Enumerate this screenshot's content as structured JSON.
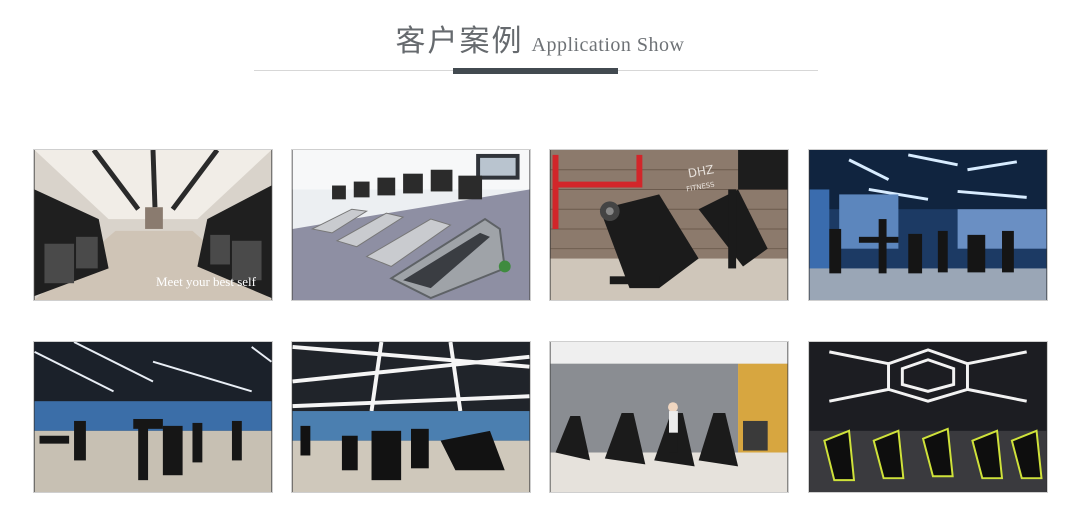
{
  "header": {
    "title_cn": "客户案例",
    "title_en": "Application Show"
  },
  "gallery": {
    "items": [
      {
        "caption": "Meet your best self",
        "brand": "",
        "scene": "gym hall with cardio machines"
      },
      {
        "caption": "",
        "brand": "",
        "scene": "treadmill row"
      },
      {
        "caption": "",
        "brand": "DHZ FITNESS",
        "scene": "strength machines in front of brick wall"
      },
      {
        "caption": "",
        "brand": "",
        "scene": "blue lit strength area"
      },
      {
        "caption": "",
        "brand": "",
        "scene": "strength machines under blue ceiling"
      },
      {
        "caption": "",
        "brand": "",
        "scene": "strength machines under lit ceiling"
      },
      {
        "caption": "",
        "brand": "",
        "scene": "treadmills with person"
      },
      {
        "caption": "",
        "brand": "",
        "scene": "spinning bikes with hexagon lights"
      }
    ]
  }
}
